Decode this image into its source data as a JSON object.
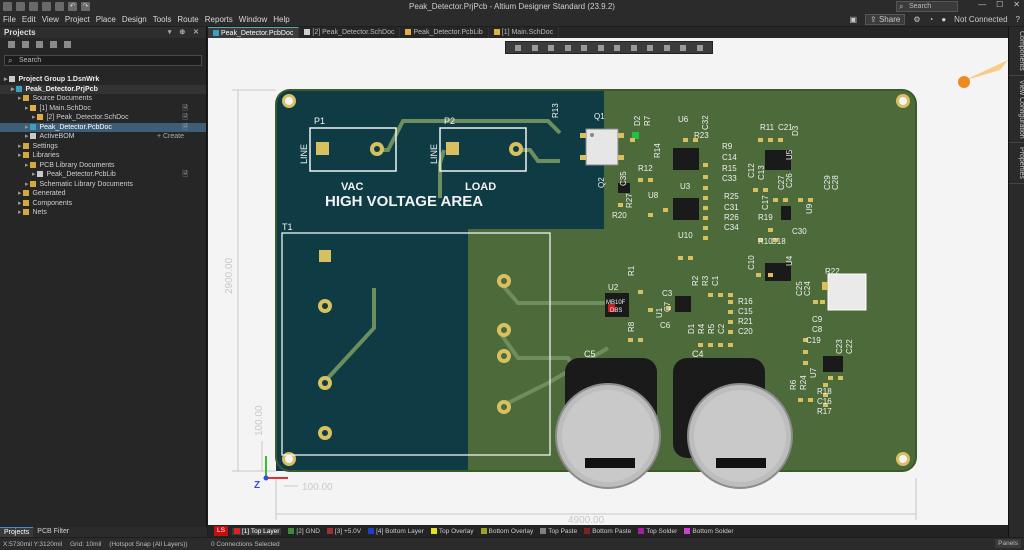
{
  "window": {
    "title": "Peak_Detector.PrjPcb - Altium Designer Standard (23.9.2)",
    "search_placeholder": "Search",
    "connection_status": "Not Connected",
    "share_label": "Share"
  },
  "menu": [
    "File",
    "Edit",
    "View",
    "Project",
    "Place",
    "Design",
    "Tools",
    "Route",
    "Reports",
    "Window",
    "Help"
  ],
  "projects_panel": {
    "title": "Projects",
    "search_placeholder": "Search",
    "tree": [
      {
        "label": "Project Group 1.DsnWrk",
        "level": 0,
        "bold": true
      },
      {
        "label": "Peak_Detector.PrjPcb",
        "level": 1,
        "bold": true,
        "selected_project": true
      },
      {
        "label": "Source Documents",
        "level": 2
      },
      {
        "label": "[1] Main.SchDoc",
        "level": 3
      },
      {
        "label": "[2] Peak_Detector.SchDoc",
        "level": 4
      },
      {
        "label": "Peak_Detector.PcbDoc",
        "level": 3,
        "selected": true
      },
      {
        "label": "ActiveBOM",
        "level": 3,
        "action": "+ Create"
      },
      {
        "label": "Settings",
        "level": 2
      },
      {
        "label": "Libraries",
        "level": 2
      },
      {
        "label": "PCB Library Documents",
        "level": 3
      },
      {
        "label": "Peak_Detector.PcbLib",
        "level": 4
      },
      {
        "label": "Schematic Library Documents",
        "level": 3
      },
      {
        "label": "Generated",
        "level": 2
      },
      {
        "label": "Components",
        "level": 2
      },
      {
        "label": "Nets",
        "level": 2
      }
    ],
    "bottom_tabs": [
      "Projects",
      "PCB Filter"
    ]
  },
  "doc_tabs": [
    "Peak_Detector.PcbDoc",
    "[2] Peak_Detector.SchDoc",
    "Peak_Detector.PcbLib",
    "[1] Main.SchDoc"
  ],
  "right_panels": [
    "Components",
    "View Configuration",
    "Properties"
  ],
  "pcb": {
    "area_label": "HIGH VOLTAGE AREA",
    "connectors": [
      {
        "ref": "P1",
        "label1": "LINE",
        "label2": "VAC"
      },
      {
        "ref": "P2",
        "label1": "LINE",
        "label2": "LOAD"
      }
    ],
    "transformer_ref": "T1",
    "dim_width": "4900.00",
    "dim_height": "2900.00",
    "dim_small_h": "100.00",
    "dim_small_v": "100.00",
    "axis_z": "Z",
    "ic_marking": [
      "MB10F",
      "DBS"
    ],
    "cap_labels": [
      "C5",
      "C4"
    ],
    "designators": [
      "R13",
      "Q1",
      "D2",
      "R7",
      "R14",
      "Q2",
      "C35",
      "R20",
      "R27",
      "U8",
      "C32",
      "R23",
      "U6",
      "R9",
      "C14",
      "R15",
      "C33",
      "U3",
      "R25",
      "C31",
      "R26",
      "C34",
      "U10",
      "R11",
      "C21",
      "D3",
      "U5",
      "C12",
      "C13",
      "C27",
      "C26",
      "C29",
      "C28",
      "R19",
      "C17",
      "U9",
      "C30",
      "R10",
      "C18",
      "C10",
      "U4",
      "R22",
      "C25",
      "C24",
      "R16",
      "C15",
      "R21",
      "C20",
      "C9",
      "C8",
      "C19",
      "C23",
      "C22",
      "R6",
      "R24",
      "U7",
      "R18",
      "C16",
      "R17",
      "U2",
      "R1",
      "R2",
      "R3",
      "C1",
      "C3",
      "U1",
      "C7",
      "C6",
      "R4",
      "R5",
      "C2",
      "D1",
      "R8",
      "R12"
    ]
  },
  "layers": {
    "ls_label": "LS",
    "items": [
      {
        "label": "[1] Top Layer",
        "color": "#e02020",
        "active": true
      },
      {
        "label": "[2] GND",
        "color": "#3c8a3c"
      },
      {
        "label": "[3] +5.0V",
        "color": "#a03030"
      },
      {
        "label": "[4] Bottom Layer",
        "color": "#2040c0"
      },
      {
        "label": "Top Overlay",
        "color": "#e8e020"
      },
      {
        "label": "Bottom Overlay",
        "color": "#a0a020"
      },
      {
        "label": "Top Paste",
        "color": "#808080"
      },
      {
        "label": "Bottom Paste",
        "color": "#802020"
      },
      {
        "label": "Top Solder",
        "color": "#a020a0"
      },
      {
        "label": "Bottom Solder",
        "color": "#d040d0"
      }
    ]
  },
  "status": {
    "coords": "X:5730mil Y:3120mil",
    "grid": "Grid: 10mil",
    "snap": "(Hotspot Snap (All Layers))",
    "connections": "0 Connections Selected",
    "panels_label": "Panels"
  },
  "colors": {
    "board_dark": "#0f3b44",
    "board_green": "#4c6a3a",
    "silkscreen": "#f2f2f2",
    "pad": "#d8c060",
    "accent_select": "#3e5e78"
  }
}
